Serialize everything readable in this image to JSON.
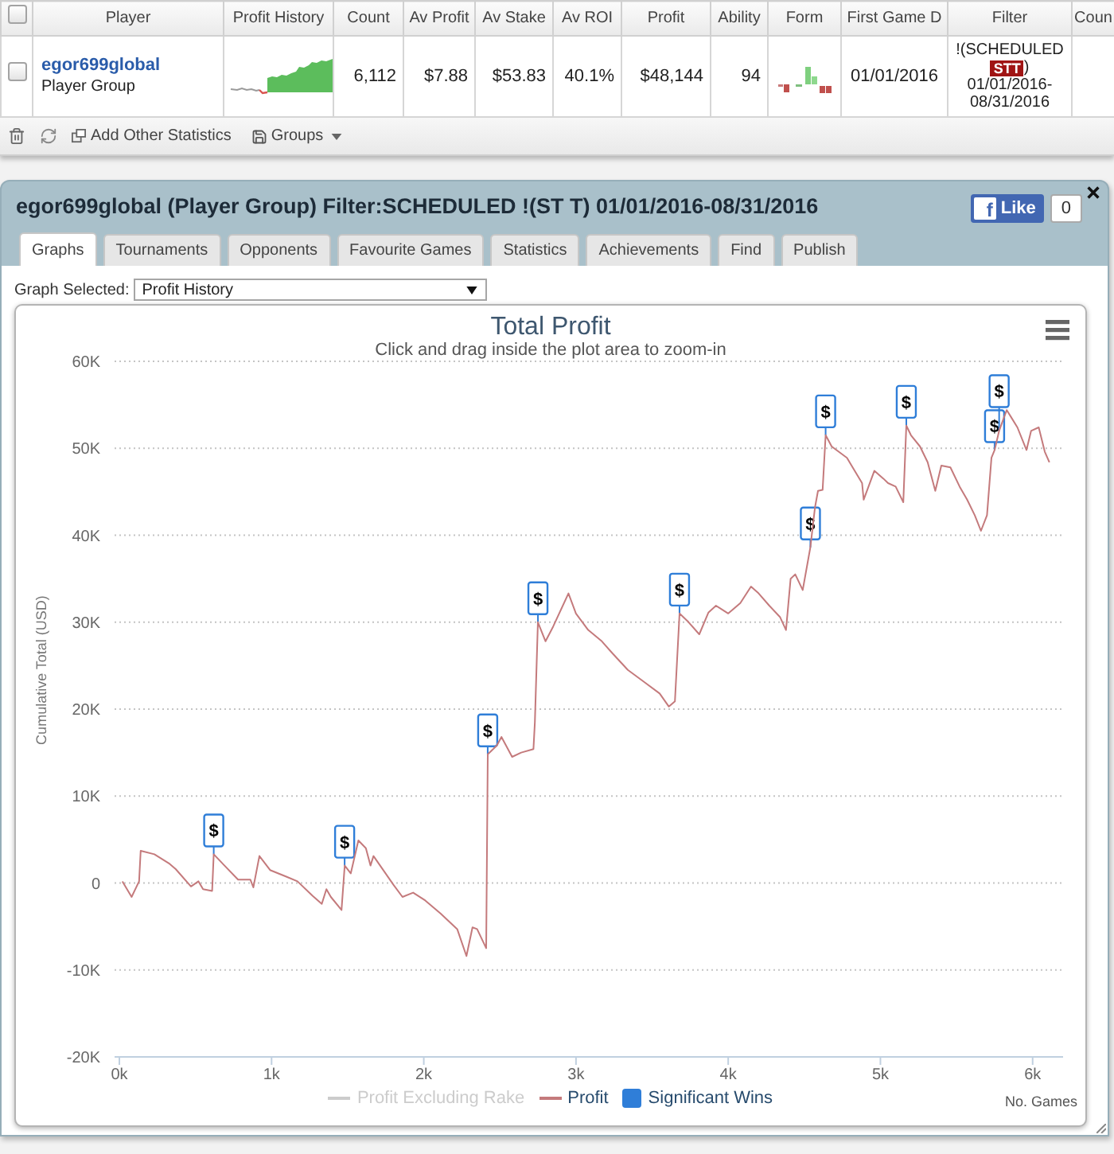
{
  "table": {
    "select_all": {
      "checked": false
    },
    "columns": [
      "Player",
      "Profit History",
      "Count",
      "Av Profit",
      "Av Stake",
      "Av ROI",
      "Profit",
      "Ability",
      "Form",
      "First Game D",
      "Filter",
      "Coun"
    ],
    "rows": [
      {
        "checked": false,
        "player": "egor699global",
        "player_type": "Player Group",
        "count": "6,112",
        "av_profit": "$7.88",
        "av_stake": "$53.83",
        "av_roi": "40.1%",
        "profit": "$48,144",
        "ability": "94",
        "first_game": "01/01/2016",
        "filter": {
          "prefix": "!(SCHEDULED",
          "tag": "STT",
          "suffix": ")",
          "dates": [
            "01/01/2016-",
            "08/31/2016"
          ]
        }
      }
    ],
    "toolbar": {
      "add_statistics": "Add Other Statistics",
      "groups": "Groups"
    }
  },
  "panel": {
    "title": "egor699global (Player Group) Filter:SCHEDULED !(ST T) 01/01/2016-08/31/2016",
    "like": {
      "logo": "f",
      "label": "Like",
      "count": "0"
    },
    "tabs": [
      {
        "label": "Graphs",
        "selected": true
      },
      {
        "label": "Tournaments",
        "selected": false
      },
      {
        "label": "Opponents",
        "selected": false
      },
      {
        "label": "Favourite Games",
        "selected": false
      },
      {
        "label": "Statistics",
        "selected": false
      },
      {
        "label": "Achievements",
        "selected": false
      },
      {
        "label": "Find",
        "selected": false
      },
      {
        "label": "Publish",
        "selected": false
      }
    ],
    "graph_select": {
      "label": "Graph Selected:",
      "value": "Profit History"
    },
    "chart": {
      "subtitle": "Click and drag inside the plot area to zoom-in",
      "chart_data": {
        "type": "line",
        "title": "Total Profit",
        "xlabel": "No. Games",
        "ylabel": "Cumulative Total (USD)",
        "grid": true,
        "xlim": [
          0,
          6200
        ],
        "ylim": [
          -20000,
          60000
        ],
        "xticks": [
          {
            "value": 0,
            "label": "0k"
          },
          {
            "value": 1000,
            "label": "1k"
          },
          {
            "value": 2000,
            "label": "2k"
          },
          {
            "value": 3000,
            "label": "3k"
          },
          {
            "value": 4000,
            "label": "4k"
          },
          {
            "value": 5000,
            "label": "5k"
          },
          {
            "value": 6000,
            "label": "6k"
          }
        ],
        "yticks": [
          {
            "value": -20000,
            "label": "-20K"
          },
          {
            "value": -10000,
            "label": "-10K"
          },
          {
            "value": 0,
            "label": "0"
          },
          {
            "value": 10000,
            "label": "10K"
          },
          {
            "value": 20000,
            "label": "20K"
          },
          {
            "value": 30000,
            "label": "30K"
          },
          {
            "value": 40000,
            "label": "40K"
          },
          {
            "value": 50000,
            "label": "50K"
          },
          {
            "value": 60000,
            "label": "60K"
          }
        ],
        "x": [
          20,
          80,
          130,
          140,
          230,
          330,
          370,
          470,
          520,
          550,
          610,
          620,
          680,
          780,
          860,
          880,
          920,
          990,
          1100,
          1170,
          1270,
          1330,
          1360,
          1390,
          1460,
          1480,
          1520,
          1570,
          1620,
          1650,
          1670,
          1800,
          1860,
          1930,
          2010,
          2110,
          2220,
          2280,
          2320,
          2350,
          2410,
          2420,
          2480,
          2510,
          2580,
          2640,
          2720,
          2730,
          2750,
          2800,
          2850,
          2950,
          3000,
          3080,
          3170,
          3240,
          3340,
          3450,
          3550,
          3610,
          3650,
          3680,
          3740,
          3810,
          3870,
          3920,
          4000,
          4080,
          4150,
          4200,
          4270,
          4340,
          4380,
          4410,
          4440,
          4490,
          4540,
          4570,
          4590,
          4620,
          4640,
          4680,
          4780,
          4810,
          4880,
          4890,
          4960,
          5020,
          5050,
          5100,
          5150,
          5170,
          5200,
          5260,
          5310,
          5360,
          5400,
          5460,
          5520,
          5570,
          5620,
          5660,
          5700,
          5730,
          5750,
          5780,
          5830,
          5900,
          5960,
          5990,
          6040,
          6080,
          6110
        ],
        "series": [
          {
            "name": "Profit",
            "color": "#c47a7c",
            "values": [
              200,
              -1600,
              200,
              3700,
              3300,
              2200,
              1600,
              -400,
              200,
              -700,
              -900,
              3300,
              2200,
              400,
              400,
              -500,
              3100,
              1500,
              700,
              200,
              -1500,
              -2400,
              -700,
              -1600,
              -3100,
              2000,
              1100,
              4900,
              4000,
              2000,
              3100,
              -200,
              -1600,
              -1100,
              -2000,
              -3500,
              -5300,
              -8400,
              -5100,
              -5300,
              -7500,
              14800,
              15800,
              16800,
              14500,
              15000,
              15400,
              18500,
              30000,
              27800,
              29500,
              33300,
              31000,
              29100,
              27800,
              26400,
              24500,
              23100,
              21800,
              20300,
              20900,
              31000,
              30000,
              28600,
              31100,
              31900,
              31000,
              32200,
              34100,
              33300,
              31900,
              30600,
              29100,
              35000,
              35500,
              33700,
              38600,
              43200,
              45100,
              45200,
              51500,
              50200,
              48900,
              48000,
              46000,
              44100,
              47400,
              46500,
              46000,
              45600,
              43800,
              52600,
              51500,
              50200,
              48400,
              45100,
              48000,
              47800,
              45600,
              44100,
              42300,
              40500,
              42300,
              48900,
              49800,
              52000,
              54400,
              52400,
              49800,
              52000,
              52400,
              49600,
              48400
            ]
          }
        ],
        "annotations": [
          {
            "x": 620,
            "y": 3300,
            "text": "$"
          },
          {
            "x": 1480,
            "y": 2000,
            "text": "$"
          },
          {
            "x": 2420,
            "y": 14800,
            "text": "$"
          },
          {
            "x": 2750,
            "y": 30000,
            "text": "$"
          },
          {
            "x": 3680,
            "y": 31000,
            "text": "$"
          },
          {
            "x": 4540,
            "y": 38600,
            "text": "$"
          },
          {
            "x": 4640,
            "y": 51500,
            "text": "$"
          },
          {
            "x": 5170,
            "y": 52600,
            "text": "$"
          },
          {
            "x": 5750,
            "y": 49800,
            "text": "$"
          },
          {
            "x": 5780,
            "y": 52000,
            "text": "$"
          }
        ]
      },
      "legend": [
        {
          "label": "Profit Excluding Rake",
          "kind": "line",
          "visible": false
        },
        {
          "kind": "series",
          "visible": true
        },
        {
          "label": "Significant Wins",
          "kind": "flags",
          "visible": true,
          "color": "#2f7ed8"
        }
      ]
    }
  }
}
